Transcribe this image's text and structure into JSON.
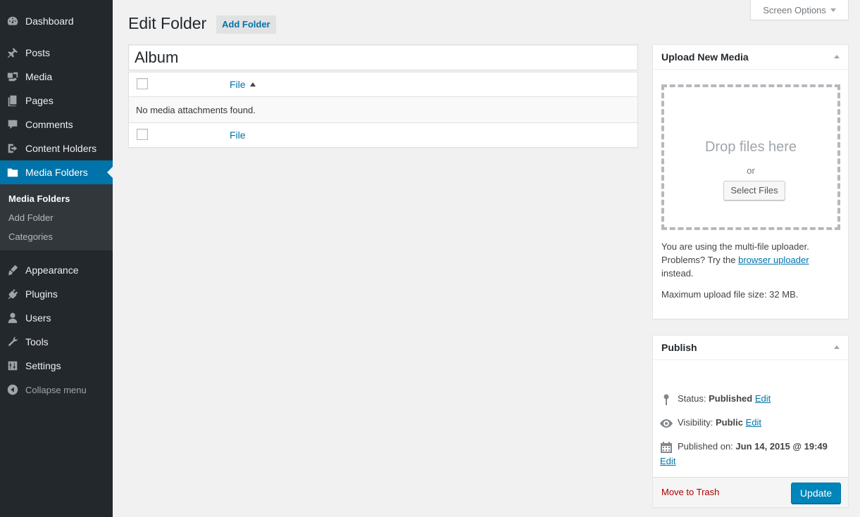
{
  "sidebar": {
    "items": [
      {
        "label": "Dashboard",
        "icon": "dashboard-icon"
      },
      {
        "label": "Posts",
        "icon": "pin-icon"
      },
      {
        "label": "Media",
        "icon": "media-icon"
      },
      {
        "label": "Pages",
        "icon": "pages-icon"
      },
      {
        "label": "Comments",
        "icon": "comment-icon"
      },
      {
        "label": "Content Holders",
        "icon": "exit-icon"
      },
      {
        "label": "Media Folders",
        "icon": "folder-icon"
      },
      {
        "label": "Appearance",
        "icon": "brush-icon"
      },
      {
        "label": "Plugins",
        "icon": "plug-icon"
      },
      {
        "label": "Users",
        "icon": "user-icon"
      },
      {
        "label": "Tools",
        "icon": "wrench-icon"
      },
      {
        "label": "Settings",
        "icon": "sliders-icon"
      }
    ],
    "submenu": [
      "Media Folders",
      "Add Folder",
      "Categories"
    ],
    "collapse_label": "Collapse menu"
  },
  "screen_options_label": "Screen Options",
  "header": {
    "title": "Edit Folder",
    "add_button": "Add Folder"
  },
  "folder_title": "Album",
  "table": {
    "column_header": "File",
    "empty_message": "No media attachments found.",
    "column_footer": "File"
  },
  "upload": {
    "title": "Upload New Media",
    "drop_text": "Drop files here",
    "or_text": "or",
    "select_button": "Select Files",
    "info_prefix": "You are using the multi-file uploader. Problems? Try the",
    "info_link": "browser uploader",
    "info_suffix": "instead.",
    "max_size": "Maximum upload file size: 32 MB."
  },
  "publish": {
    "title": "Publish",
    "status_label": "Status:",
    "status_value": "Published",
    "visibility_label": "Visibility:",
    "visibility_value": "Public",
    "published_label": "Published on:",
    "published_value": "Jun 14, 2015 @ 19:49",
    "edit_label": "Edit",
    "trash_label": "Move to Trash",
    "update_label": "Update"
  },
  "colors": {
    "sidebar_bg": "#23282d",
    "active_bg": "#0073aa",
    "link": "#0073aa",
    "trash": "#aa0000",
    "primary_button": "#0085ba"
  }
}
